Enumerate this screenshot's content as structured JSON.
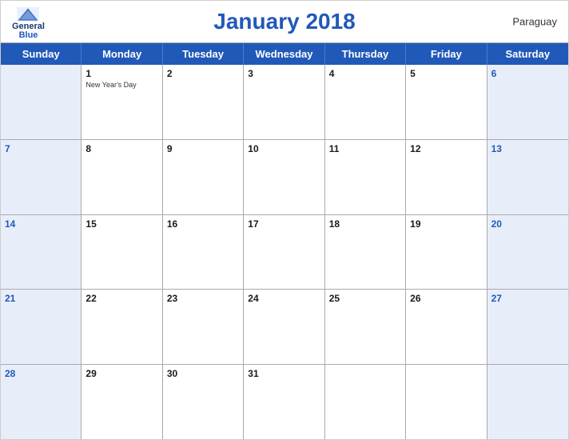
{
  "header": {
    "title": "January 2018",
    "country": "Paraguay",
    "logo": {
      "general": "General",
      "blue": "Blue"
    }
  },
  "days_of_week": [
    "Sunday",
    "Monday",
    "Tuesday",
    "Wednesday",
    "Thursday",
    "Friday",
    "Saturday"
  ],
  "weeks": [
    [
      {
        "day": "",
        "type": "sunday"
      },
      {
        "day": "1",
        "type": "weekday",
        "holiday": "New Year's Day"
      },
      {
        "day": "2",
        "type": "weekday"
      },
      {
        "day": "3",
        "type": "weekday"
      },
      {
        "day": "4",
        "type": "weekday"
      },
      {
        "day": "5",
        "type": "weekday"
      },
      {
        "day": "6",
        "type": "saturday"
      }
    ],
    [
      {
        "day": "7",
        "type": "sunday"
      },
      {
        "day": "8",
        "type": "weekday"
      },
      {
        "day": "9",
        "type": "weekday"
      },
      {
        "day": "10",
        "type": "weekday"
      },
      {
        "day": "11",
        "type": "weekday"
      },
      {
        "day": "12",
        "type": "weekday"
      },
      {
        "day": "13",
        "type": "saturday"
      }
    ],
    [
      {
        "day": "14",
        "type": "sunday"
      },
      {
        "day": "15",
        "type": "weekday"
      },
      {
        "day": "16",
        "type": "weekday"
      },
      {
        "day": "17",
        "type": "weekday"
      },
      {
        "day": "18",
        "type": "weekday"
      },
      {
        "day": "19",
        "type": "weekday"
      },
      {
        "day": "20",
        "type": "saturday"
      }
    ],
    [
      {
        "day": "21",
        "type": "sunday"
      },
      {
        "day": "22",
        "type": "weekday"
      },
      {
        "day": "23",
        "type": "weekday"
      },
      {
        "day": "24",
        "type": "weekday"
      },
      {
        "day": "25",
        "type": "weekday"
      },
      {
        "day": "26",
        "type": "weekday"
      },
      {
        "day": "27",
        "type": "saturday"
      }
    ],
    [
      {
        "day": "28",
        "type": "sunday"
      },
      {
        "day": "29",
        "type": "weekday"
      },
      {
        "day": "30",
        "type": "weekday"
      },
      {
        "day": "31",
        "type": "weekday"
      },
      {
        "day": "",
        "type": "empty"
      },
      {
        "day": "",
        "type": "empty"
      },
      {
        "day": "",
        "type": "saturday-empty"
      }
    ]
  ]
}
